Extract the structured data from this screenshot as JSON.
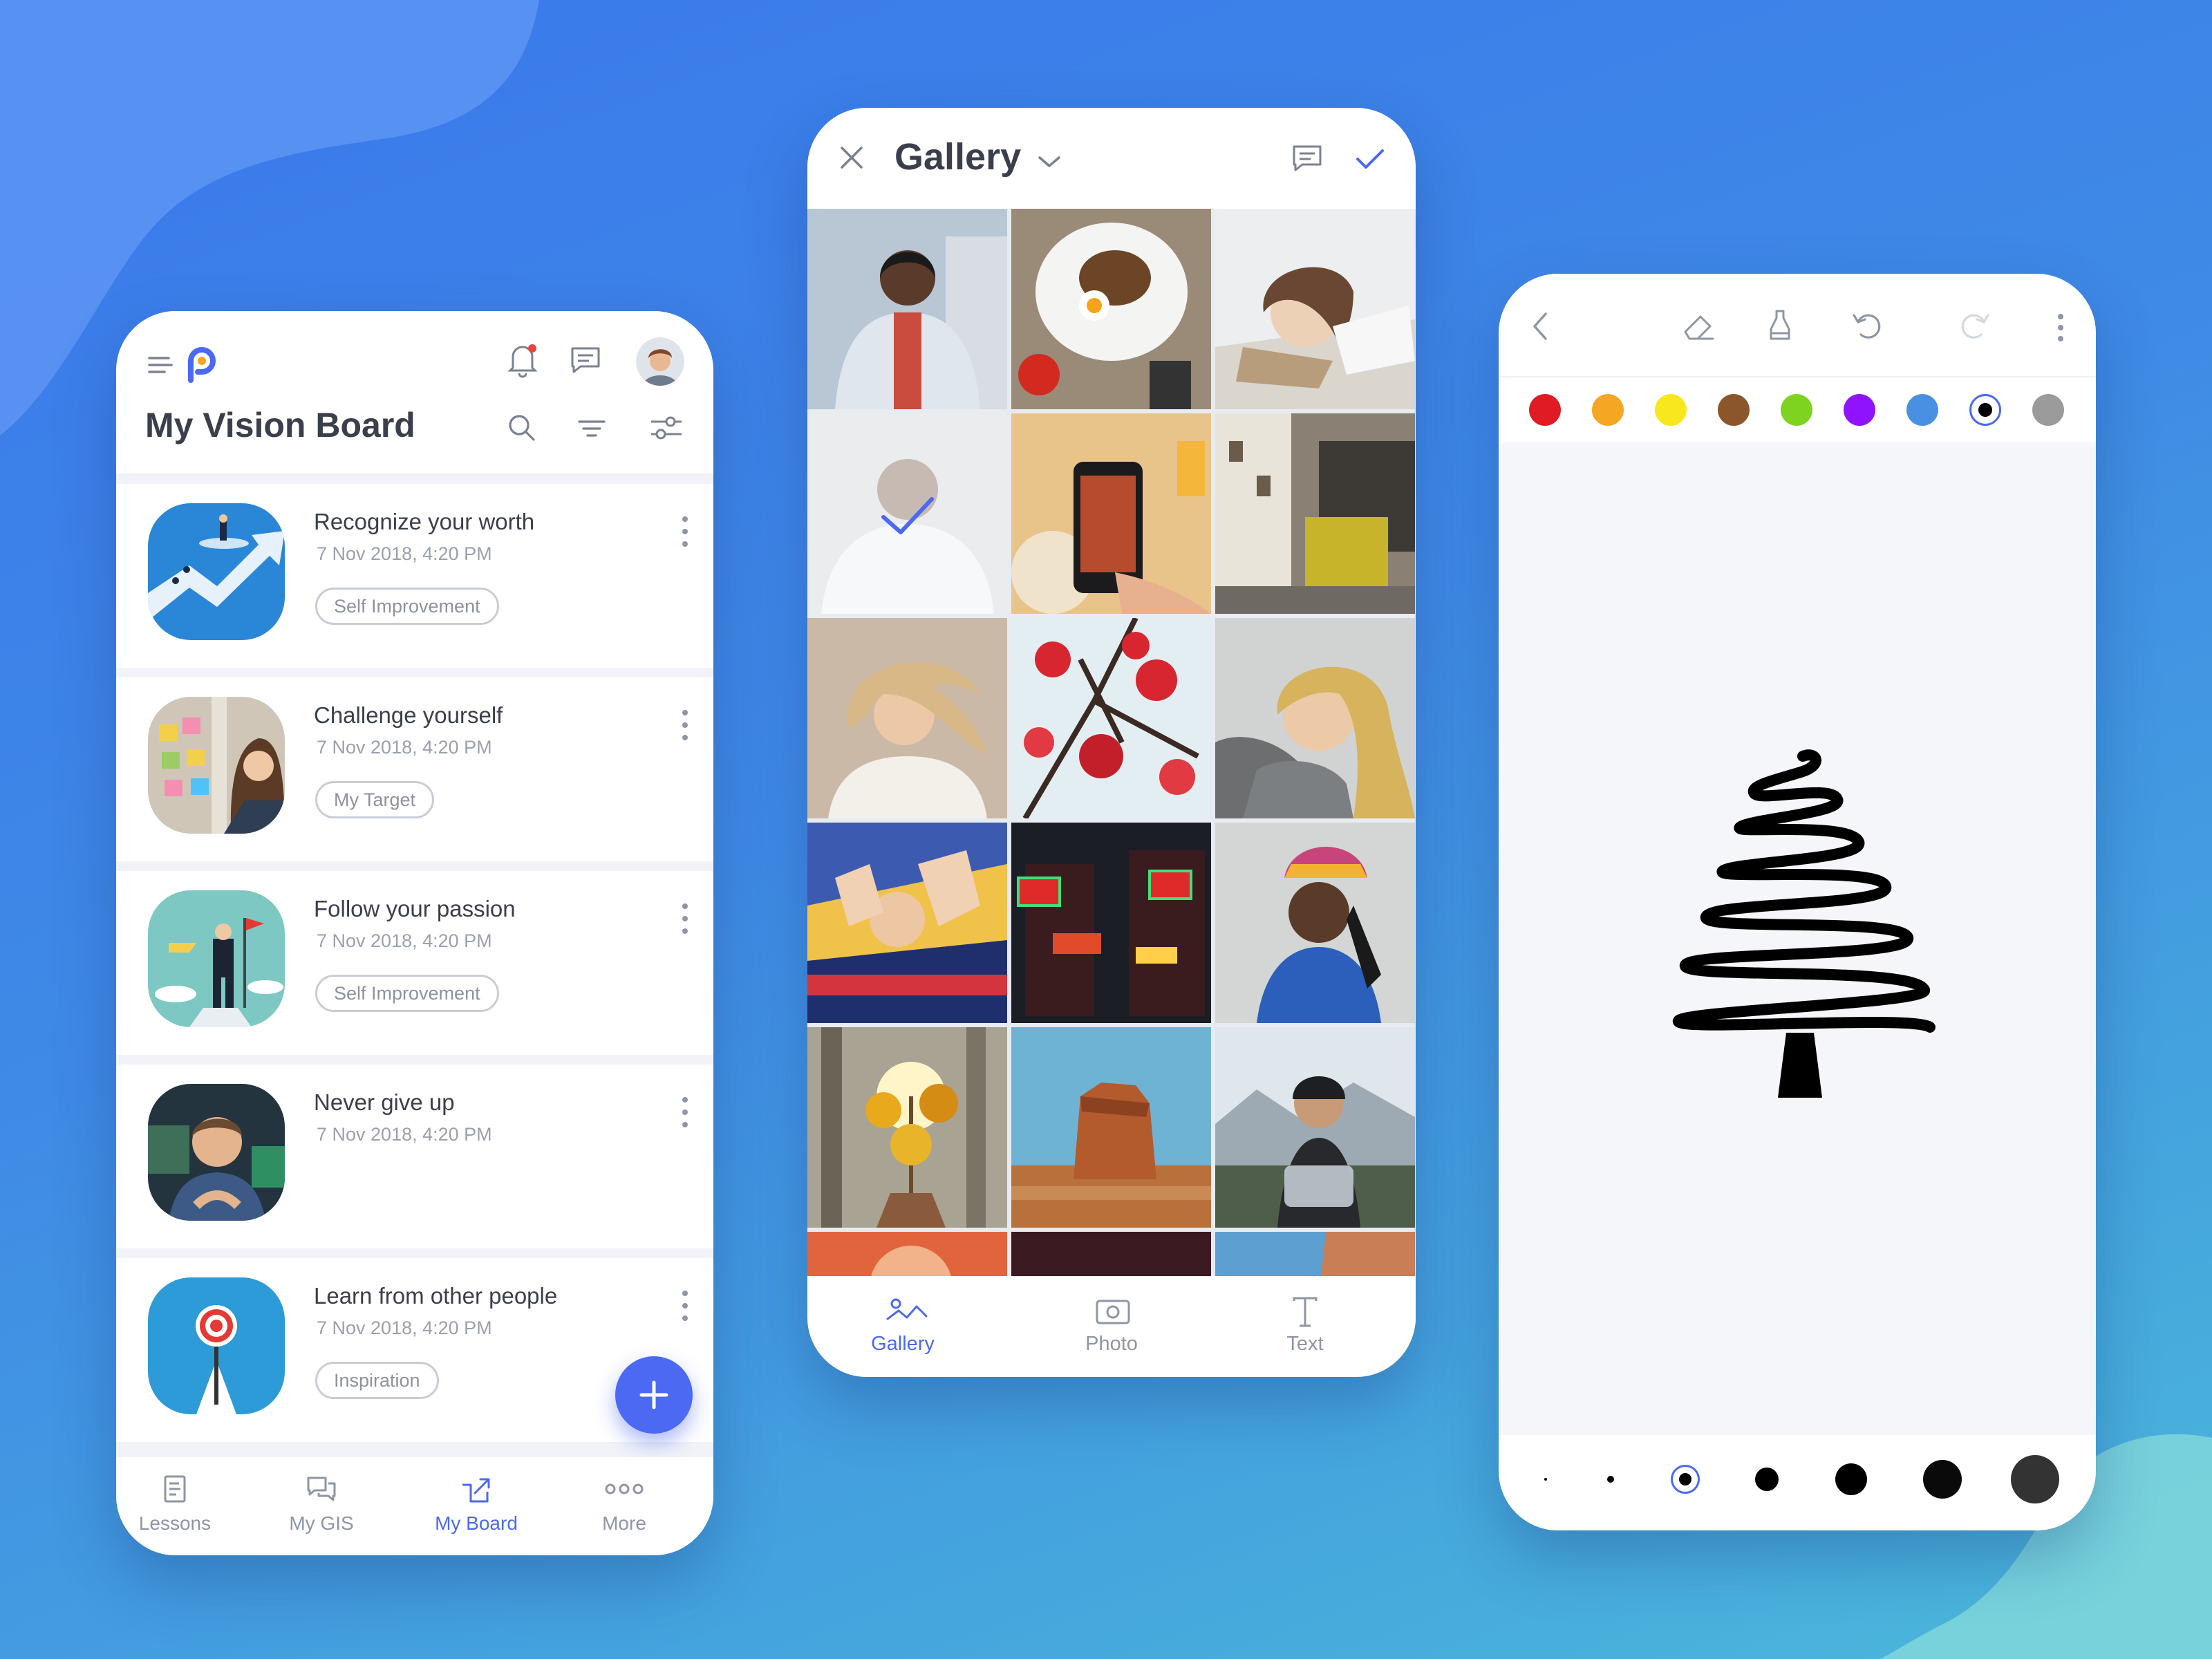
{
  "colors": {
    "accent": "#4b69f3",
    "text_dark": "#3a3f4b",
    "text_muted": "#9aa0ac",
    "background": "#3f8ae6"
  },
  "vision_board": {
    "title": "My Vision Board",
    "header_icons": [
      "menu-icon",
      "app-logo",
      "notification-bell-icon",
      "chat-icon",
      "avatar",
      "search-icon",
      "filter-icon",
      "sliders-icon"
    ],
    "cards": [
      {
        "title": "Recognize your worth",
        "date": "7 Nov 2018, 4:20 PM",
        "tag": "Self Improvement"
      },
      {
        "title": "Challenge yourself",
        "date": "7 Nov 2018, 4:20 PM",
        "tag": "My Target"
      },
      {
        "title": "Follow your passion",
        "date": "7 Nov 2018, 4:20 PM",
        "tag": "Self Improvement"
      },
      {
        "title": "Never give up",
        "date": "7 Nov 2018, 4:20 PM",
        "tag": ""
      },
      {
        "title": "Learn from other people",
        "date": "7 Nov 2018, 4:20 PM",
        "tag": "Inspiration"
      }
    ],
    "fab_icon": "plus-icon",
    "nav": [
      {
        "label": "Lessons",
        "icon": "document-icon",
        "active": false
      },
      {
        "label": "My GIS",
        "icon": "chat-bubbles-icon",
        "active": false
      },
      {
        "label": "My Board",
        "icon": "board-icon",
        "active": true
      },
      {
        "label": "More",
        "icon": "more-dots-icon",
        "active": false
      }
    ]
  },
  "gallery": {
    "title": "Gallery",
    "header_icons": [
      "close-icon",
      "chevron-down-icon",
      "comment-icon",
      "check-icon"
    ],
    "photos": [
      "man-in-white-jacket",
      "breakfast-plate",
      "woman-sleeping-on-book",
      "selected-man-portrait",
      "phone-photo-of-food",
      "old-town-street",
      "woman-hair-in-wind",
      "red-blossoms",
      "blonde-woman-sweater",
      "woman-hands-sunlight",
      "neon-chinese-signs",
      "woman-colorful-headscarf",
      "hand-holding-yellow-leaves",
      "desert-butte",
      "motorcycle-rider-snow",
      "partial-row-1",
      "partial-row-2",
      "partial-row-3"
    ],
    "selected_index": 3,
    "tabs": [
      {
        "label": "Gallery",
        "icon": "gallery-icon",
        "active": true
      },
      {
        "label": "Photo",
        "icon": "camera-icon",
        "active": false
      },
      {
        "label": "Text",
        "icon": "text-icon",
        "active": false
      }
    ]
  },
  "drawing": {
    "toolbar_icons": [
      "back-icon",
      "eraser-icon",
      "highlighter-icon",
      "undo-icon",
      "redo-icon",
      "more-vertical-icon"
    ],
    "palette": [
      "#e01b24",
      "#f5a623",
      "#f8e71c",
      "#8b572a",
      "#7ed321",
      "#9013fe",
      "#4a90e2",
      "#000000",
      "#9b9b9b"
    ],
    "selected_color": 7,
    "brush_sizes": [
      1,
      2,
      3,
      4,
      5,
      6,
      7
    ],
    "selected_brush": 2
  }
}
